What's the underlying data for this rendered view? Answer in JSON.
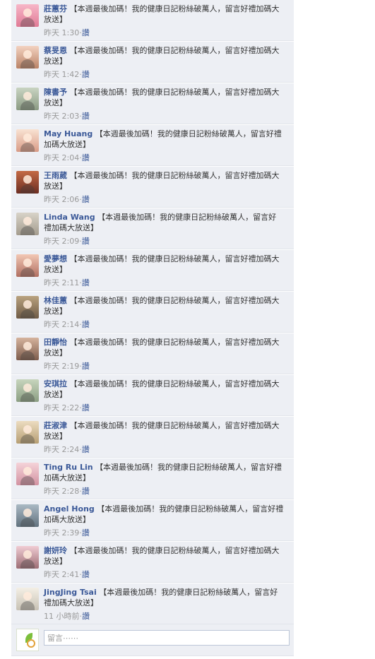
{
  "comments": [
    {
      "name": "莊蕙芬",
      "message": "【本週最後加碼！我的健康日記粉絲破萬人，留言好禮加碼大放送】",
      "time": "昨天 1:30",
      "like": "讚"
    },
    {
      "name": "蔡旻恩",
      "message": "【本週最後加碼！我的健康日記粉絲破萬人，留言好禮加碼大放送】",
      "time": "昨天 1:42",
      "like": "讚"
    },
    {
      "name": "陳書予",
      "message": "【本週最後加碼！我的健康日記粉絲破萬人，留言好禮加碼大放送】",
      "time": "昨天 2:03",
      "like": "讚"
    },
    {
      "name": "May Huang",
      "message": "【本週最後加碼！我的健康日記粉絲破萬人，留言好禮加碼大放送】",
      "time": "昨天 2:04",
      "like": "讚"
    },
    {
      "name": "王雨葳",
      "message": "【本週最後加碼！我的健康日記粉絲破萬人，留言好禮加碼大放送】",
      "time": "昨天 2:06",
      "like": "讚"
    },
    {
      "name": "Linda Wang",
      "message": "【本週最後加碼！我的健康日記粉絲破萬人，留言好禮加碼大放送】",
      "time": "昨天 2:09",
      "like": "讚"
    },
    {
      "name": "愛夢想",
      "message": "【本週最後加碼！我的健康日記粉絲破萬人，留言好禮加碼大放送】",
      "time": "昨天 2:11",
      "like": "讚"
    },
    {
      "name": "林佳蕙",
      "message": "【本週最後加碼！我的健康日記粉絲破萬人，留言好禮加碼大放送】",
      "time": "昨天 2:14",
      "like": "讚"
    },
    {
      "name": "田靜怡",
      "message": "【本週最後加碼！我的健康日記粉絲破萬人，留言好禮加碼大放送】",
      "time": "昨天 2:19",
      "like": "讚"
    },
    {
      "name": "安琪拉",
      "message": "【本週最後加碼！我的健康日記粉絲破萬人，留言好禮加碼大放送】",
      "time": "昨天 2:22",
      "like": "讚"
    },
    {
      "name": "莊淑津",
      "message": "【本週最後加碼！我的健康日記粉絲破萬人，留言好禮加碼大放送】",
      "time": "昨天 2:24",
      "like": "讚"
    },
    {
      "name": "Ting Ru Lin",
      "message": "【本週最後加碼！我的健康日記粉絲破萬人，留言好禮加碼大放送】",
      "time": "昨天 2:28",
      "like": "讚"
    },
    {
      "name": "Angel Hong",
      "message": "【本週最後加碼！我的健康日記粉絲破萬人，留言好禮加碼大放送】",
      "time": "昨天 2:39",
      "like": "讚"
    },
    {
      "name": "謝妍玲",
      "message": "【本週最後加碼！我的健康日記粉絲破萬人，留言好禮加碼大放送】",
      "time": "昨天 2:41",
      "like": "讚"
    },
    {
      "name": "JingJing Tsai",
      "message": "【本週最後加碼！我的健康日記粉絲破萬人，留言好禮加碼大放送】",
      "time": "11 小時前",
      "like": "讚"
    }
  ],
  "comment_box": {
    "placeholder": "留言⋯⋯"
  },
  "colors": {
    "panel": "#edeff4",
    "name_link": "#3b5998",
    "meta_text": "#999999"
  }
}
